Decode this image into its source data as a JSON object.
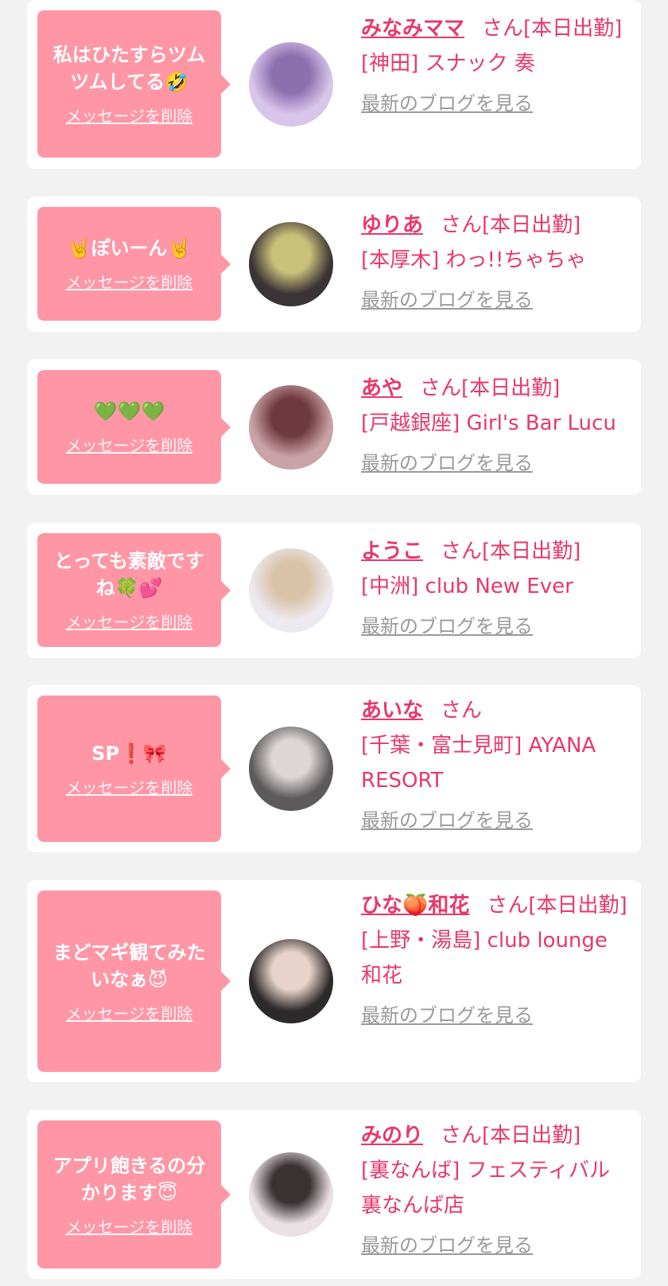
{
  "delete_label": "メッセージを削除",
  "blog_label": "最新のブログを見る",
  "entries": [
    {
      "message": "私はひたすらツムツムしてる🤣",
      "name": "みなみママ",
      "suffix": "さん[本日出勤]",
      "shop": "[神田] スナック 奏",
      "avatar_colors": [
        "#d8c6ea",
        "#8d6fb0"
      ]
    },
    {
      "message": "🤘ぽいーん🤘",
      "name": "ゆりあ",
      "suffix": "さん[本日出勤]",
      "shop": "[本厚木] わっ!!ちゃちゃ",
      "avatar_colors": [
        "#3b3436",
        "#c9c07a"
      ]
    },
    {
      "message": "💚💚💚",
      "name": "あや",
      "suffix": "さん[本日出勤]",
      "shop": "[戸越銀座] Girl's Bar Lucu",
      "avatar_colors": [
        "#c9a3a8",
        "#6f3a3f"
      ]
    },
    {
      "message": "とっても素敵ですね🍀💕",
      "name": "ようこ",
      "suffix": "さん[本日出勤]",
      "shop": "[中洲] club New Ever",
      "avatar_colors": [
        "#eceaf0",
        "#d9c2a8"
      ]
    },
    {
      "message": "SP❗🎀",
      "name": "あいな",
      "suffix": "さん",
      "shop": "[千葉・富士見町] AYANA RESORT",
      "avatar_colors": [
        "#5d5a5c",
        "#ddd6d4"
      ]
    },
    {
      "message": "まどマギ観てみたいなぁ😈",
      "name": "ひな🍑和花",
      "suffix": "さん[本日出勤]",
      "shop": "[上野・湯島] club lounge 和花",
      "avatar_colors": [
        "#2d2a2c",
        "#e8d2c9"
      ]
    },
    {
      "message": "アプリ飽きるの分かります😇",
      "name": "みのり",
      "suffix": "さん[本日出勤]",
      "shop": "[裏なんば] フェスティバル 裏なんば店",
      "avatar_colors": [
        "#e9e1e4",
        "#3a3133"
      ]
    }
  ]
}
